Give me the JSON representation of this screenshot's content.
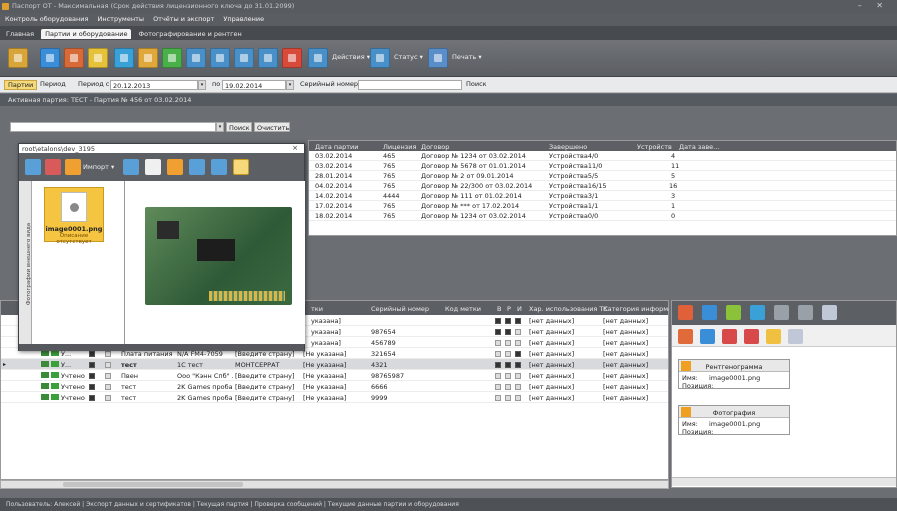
{
  "window": {
    "title": "Паспорт ОТ - Максимальная (Срок действия лицензионного ключа до 31.01.2099)",
    "controls": "– ✕"
  },
  "menu": [
    "Контроль оборудования",
    "Инструменты",
    "Отчёты и экспорт",
    "Управление"
  ],
  "tabs": [
    "Главная",
    "Партии и оборудование",
    "Фотографирование и рентген"
  ],
  "toolbar": {
    "actions_label": "Действия ▾",
    "status_label": "Статус ▾",
    "print_label": "Печать ▾"
  },
  "filter": {
    "batches_label": "Партии",
    "period_label": "Период",
    "period_from_label": "Период с",
    "date_from": "20.12.2013",
    "to_label": "по",
    "date_to": "19.02.2014",
    "serial_label": "Серийный номер",
    "search_label": "Поиск"
  },
  "active_batch": "Активная партия: ТЕСТ - Партия № 456 от 03.02.2014",
  "search_row": {
    "find_button": "Поиск",
    "clear_button": "Очистить"
  },
  "batches": {
    "columns": [
      "Дата партии",
      "Лицензия",
      "Договор",
      "Завершено",
      "Устройств",
      "Дата заве..."
    ],
    "rows": [
      [
        "03.02.2014",
        "465",
        "Договор № 1234 от 03.02.2014",
        "Устройства4/0",
        "4",
        ""
      ],
      [
        "03.02.2014",
        "765",
        "Договор № 5678 от 01.01.2014",
        "Устройства11/0",
        "11",
        ""
      ],
      [
        "28.01.2014",
        "765",
        "Договор № 2 от 09.01.2014",
        "Устройства5/5",
        "5",
        ""
      ],
      [
        "04.02.2014",
        "765",
        "Договор № 22/300 от 03.02.2014",
        "Устройства16/15",
        "16",
        ""
      ],
      [
        "14.02.2014",
        "4444",
        "Договор № 111 от 01.02.2014",
        "Устройства3/1",
        "3",
        ""
      ],
      [
        "17.02.2014",
        "765",
        "Договор № *** от 17.02.2014",
        "Устройства1/1",
        "1",
        ""
      ],
      [
        "18.02.2014",
        "765",
        "Договор № 1234 от 03.02.2014",
        "Устройства0/0",
        "0",
        ""
      ]
    ]
  },
  "popup": {
    "title": "root\\etalons\\dev_3195",
    "import_label": "Импорт ▾",
    "side_label": "Фотографии внешнего вида",
    "thumb_name": "image0001.png",
    "thumb_desc": "Описание отсутствует"
  },
  "equipment": {
    "columns": [
      "тки",
      "Серийный номер",
      "Код метки",
      "В",
      "Р",
      "И",
      "Хар. использования ТС",
      "Категория информац"
    ],
    "rows": [
      {
        "status": "",
        "name": "",
        "model": "",
        "mfr": "",
        "country": "",
        "mark": "указана]",
        "serial": "",
        "sq": [
          "dark",
          "dark",
          "dark"
        ],
        "usage": "[нет данных]",
        "category": "[нет данных]"
      },
      {
        "status": "",
        "name": "",
        "model": "",
        "mfr": "",
        "country": "",
        "mark": "указана]",
        "serial": "987654",
        "sq": [
          "dark",
          "dark",
          "light"
        ],
        "usage": "[нет данных]",
        "category": "[нет данных]"
      },
      {
        "status": "",
        "name": "",
        "model": "",
        "mfr": "",
        "country": "",
        "mark": "указана]",
        "serial": "456789",
        "sq": [
          "light",
          "light",
          "light"
        ],
        "usage": "[нет данных]",
        "category": "[нет данных]"
      },
      {
        "status": "У...",
        "name": "Плата питания",
        "model": "N/A FM4-7059",
        "mfr": "[Введите страну]",
        "country": "",
        "mark": "[Не указана]",
        "serial": "321654",
        "sq": [
          "light",
          "light",
          "dark"
        ],
        "usage": "[нет данных]",
        "category": "[нет данных]"
      },
      {
        "status": "У...",
        "name": "тест",
        "model": "1С тест",
        "mfr": "МОНТСЕРРАТ",
        "country": "",
        "mark": "[Не указана]",
        "serial": "4321",
        "sq": [
          "dark",
          "dark",
          "dark"
        ],
        "usage": "[нет данных]",
        "category": "[нет данных]"
      },
      {
        "status": "Учтено",
        "name": "Пвен",
        "model": "Ооо \"Кэнн Спб\" ...",
        "mfr": "[Введите страну]",
        "country": "",
        "mark": "[Не указана]",
        "serial": "98765987",
        "sq": [
          "light",
          "light",
          "light"
        ],
        "usage": "[нет данных]",
        "category": "[нет данных]"
      },
      {
        "status": "Учтено",
        "name": "тест",
        "model": "2K Games проба",
        "mfr": "[Введите страну]",
        "country": "",
        "mark": "[Не указана]",
        "serial": "6666",
        "sq": [
          "light",
          "light",
          "light"
        ],
        "usage": "[нет данных]",
        "category": "[нет данных]"
      },
      {
        "status": "Учтено",
        "name": "тест",
        "model": "2K Games проба",
        "mfr": "[Введите страну]",
        "country": "",
        "mark": "[Не указана]",
        "serial": "9999",
        "sq": [
          "light",
          "light",
          "light"
        ],
        "usage": "[нет данных]",
        "category": "[нет данных]"
      }
    ]
  },
  "right_panel": {
    "cards": [
      {
        "title": "Рентгенограмма",
        "name_label": "Имя:",
        "name_value": "image0001.png",
        "pos_label": "Позиция:"
      },
      {
        "title": "Фотография",
        "name_label": "Имя:",
        "name_value": "image0001.png",
        "pos_label": "Позиция:"
      }
    ]
  },
  "statusbar": "Пользователь: Алексей | Экспорт данных и сертификатов | Текущая партия | Проверка сообщений | Текущие данные партии и оборудования"
}
